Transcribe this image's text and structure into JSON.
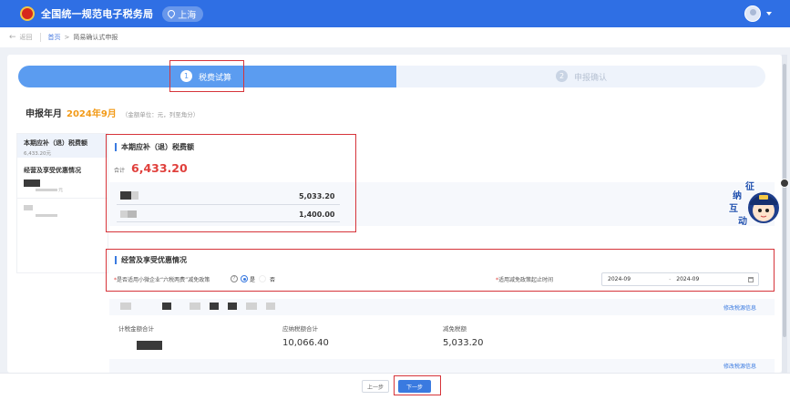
{
  "header": {
    "title": "全国统一规范电子税务局",
    "region": "上海",
    "emblem_icon": "national-emblem-icon",
    "avatar_icon": "user-avatar-icon"
  },
  "breadcrumb": {
    "back_label": "返回",
    "home": "首页",
    "separator": ">",
    "current": "简易确认式申报"
  },
  "steps": [
    {
      "num": "1",
      "label": "税费试算",
      "active": true
    },
    {
      "num": "2",
      "label": "申报确认",
      "active": false
    }
  ],
  "period": {
    "label": "申报年月",
    "value": "2024年9月",
    "unit_note": "（金额单位：元，列至角分）"
  },
  "sidebar": {
    "items": [
      {
        "title": "本期应补（退）税费额",
        "sub": "6,433.20元"
      },
      {
        "title": "经营及享受优惠情况",
        "sub": ""
      }
    ],
    "masked_sub": "元"
  },
  "tax_card": {
    "title": "本期应补（退）税费额",
    "total_label": "合计",
    "total_value": "6,433.20",
    "rows": [
      {
        "amount": "5,033.20"
      },
      {
        "amount": "1,400.00"
      }
    ]
  },
  "preference_card": {
    "title": "经营及享受优惠情况",
    "question_label": "是否适用小微企业“六税两费”减免政策",
    "required_mark": "*",
    "options": [
      {
        "label": "是",
        "selected": true
      },
      {
        "label": "否",
        "selected": false
      }
    ],
    "date_label": "适用减免政策起止时间",
    "date_from": "2024-09",
    "date_separator": "-",
    "date_to": "2024-09",
    "edit_link": "修改税源信息",
    "stats": [
      {
        "label": "计税金额合计",
        "value": ""
      },
      {
        "label": "应纳税额合计",
        "value": "10,066.40"
      },
      {
        "label": "减免税额",
        "value": "5,033.20"
      }
    ],
    "edit_link_2": "修改税源信息"
  },
  "footer": {
    "prev_label": "上一步",
    "next_label": "下一步"
  },
  "mascot": {
    "text_1": "征",
    "text_2": "纳",
    "text_3": "互",
    "text_4": "动"
  },
  "accent_colors": {
    "primary": "#2f6fe4",
    "step_active": "#5b9cf0",
    "highlight": "#d6343a",
    "amount_red": "#e0403c",
    "period_orange": "#f29a17"
  }
}
